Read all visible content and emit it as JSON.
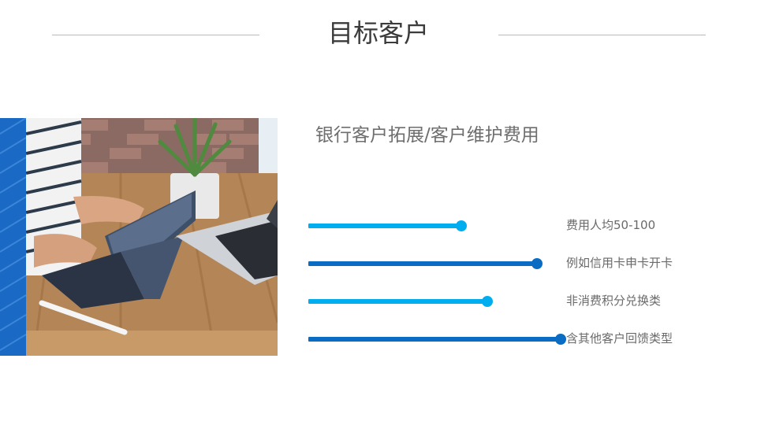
{
  "header": {
    "title": "目标客户"
  },
  "content": {
    "subtitle": "银行客户拓展/客户维护费用",
    "image_desc_icon": "photo-laptop-tablet-desk",
    "items": [
      {
        "label": "费用人均50-100",
        "level": 0.6,
        "color": "#00aeef"
      },
      {
        "label": "例如信用卡申卡开卡",
        "level": 0.9,
        "color": "#0a6cc2"
      },
      {
        "label": "非消费积分兑换类",
        "level": 0.7,
        "color": "#00aeef"
      },
      {
        "label": "含其他客户回馈类型",
        "level": 0.99,
        "color": "#0a6cc2"
      }
    ]
  },
  "colors": {
    "accent_light": "#00aeef",
    "accent_dark": "#0a6cc2",
    "strip": "#1a6ac5"
  }
}
